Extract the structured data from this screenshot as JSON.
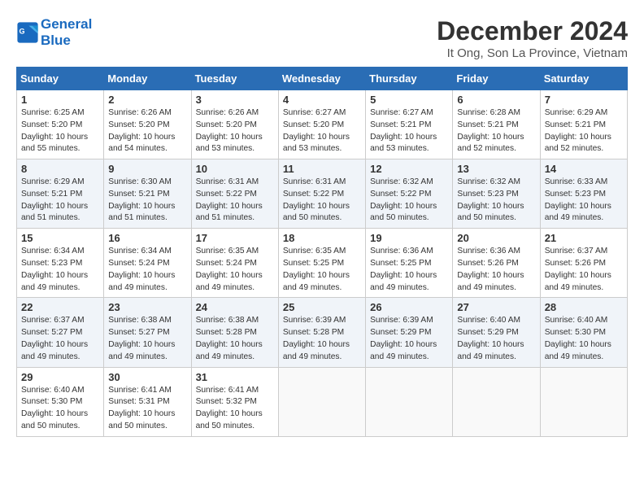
{
  "logo": {
    "line1": "General",
    "line2": "Blue"
  },
  "title": "December 2024",
  "subtitle": "It Ong, Son La Province, Vietnam",
  "weekdays": [
    "Sunday",
    "Monday",
    "Tuesday",
    "Wednesday",
    "Thursday",
    "Friday",
    "Saturday"
  ],
  "weeks": [
    [
      {
        "day": "1",
        "sunrise": "6:25 AM",
        "sunset": "5:20 PM",
        "daylight": "10 hours and 55 minutes."
      },
      {
        "day": "2",
        "sunrise": "6:26 AM",
        "sunset": "5:20 PM",
        "daylight": "10 hours and 54 minutes."
      },
      {
        "day": "3",
        "sunrise": "6:26 AM",
        "sunset": "5:20 PM",
        "daylight": "10 hours and 53 minutes."
      },
      {
        "day": "4",
        "sunrise": "6:27 AM",
        "sunset": "5:20 PM",
        "daylight": "10 hours and 53 minutes."
      },
      {
        "day": "5",
        "sunrise": "6:27 AM",
        "sunset": "5:21 PM",
        "daylight": "10 hours and 53 minutes."
      },
      {
        "day": "6",
        "sunrise": "6:28 AM",
        "sunset": "5:21 PM",
        "daylight": "10 hours and 52 minutes."
      },
      {
        "day": "7",
        "sunrise": "6:29 AM",
        "sunset": "5:21 PM",
        "daylight": "10 hours and 52 minutes."
      }
    ],
    [
      {
        "day": "8",
        "sunrise": "6:29 AM",
        "sunset": "5:21 PM",
        "daylight": "10 hours and 51 minutes."
      },
      {
        "day": "9",
        "sunrise": "6:30 AM",
        "sunset": "5:21 PM",
        "daylight": "10 hours and 51 minutes."
      },
      {
        "day": "10",
        "sunrise": "6:31 AM",
        "sunset": "5:22 PM",
        "daylight": "10 hours and 51 minutes."
      },
      {
        "day": "11",
        "sunrise": "6:31 AM",
        "sunset": "5:22 PM",
        "daylight": "10 hours and 50 minutes."
      },
      {
        "day": "12",
        "sunrise": "6:32 AM",
        "sunset": "5:22 PM",
        "daylight": "10 hours and 50 minutes."
      },
      {
        "day": "13",
        "sunrise": "6:32 AM",
        "sunset": "5:23 PM",
        "daylight": "10 hours and 50 minutes."
      },
      {
        "day": "14",
        "sunrise": "6:33 AM",
        "sunset": "5:23 PM",
        "daylight": "10 hours and 49 minutes."
      }
    ],
    [
      {
        "day": "15",
        "sunrise": "6:34 AM",
        "sunset": "5:23 PM",
        "daylight": "10 hours and 49 minutes."
      },
      {
        "day": "16",
        "sunrise": "6:34 AM",
        "sunset": "5:24 PM",
        "daylight": "10 hours and 49 minutes."
      },
      {
        "day": "17",
        "sunrise": "6:35 AM",
        "sunset": "5:24 PM",
        "daylight": "10 hours and 49 minutes."
      },
      {
        "day": "18",
        "sunrise": "6:35 AM",
        "sunset": "5:25 PM",
        "daylight": "10 hours and 49 minutes."
      },
      {
        "day": "19",
        "sunrise": "6:36 AM",
        "sunset": "5:25 PM",
        "daylight": "10 hours and 49 minutes."
      },
      {
        "day": "20",
        "sunrise": "6:36 AM",
        "sunset": "5:26 PM",
        "daylight": "10 hours and 49 minutes."
      },
      {
        "day": "21",
        "sunrise": "6:37 AM",
        "sunset": "5:26 PM",
        "daylight": "10 hours and 49 minutes."
      }
    ],
    [
      {
        "day": "22",
        "sunrise": "6:37 AM",
        "sunset": "5:27 PM",
        "daylight": "10 hours and 49 minutes."
      },
      {
        "day": "23",
        "sunrise": "6:38 AM",
        "sunset": "5:27 PM",
        "daylight": "10 hours and 49 minutes."
      },
      {
        "day": "24",
        "sunrise": "6:38 AM",
        "sunset": "5:28 PM",
        "daylight": "10 hours and 49 minutes."
      },
      {
        "day": "25",
        "sunrise": "6:39 AM",
        "sunset": "5:28 PM",
        "daylight": "10 hours and 49 minutes."
      },
      {
        "day": "26",
        "sunrise": "6:39 AM",
        "sunset": "5:29 PM",
        "daylight": "10 hours and 49 minutes."
      },
      {
        "day": "27",
        "sunrise": "6:40 AM",
        "sunset": "5:29 PM",
        "daylight": "10 hours and 49 minutes."
      },
      {
        "day": "28",
        "sunrise": "6:40 AM",
        "sunset": "5:30 PM",
        "daylight": "10 hours and 49 minutes."
      }
    ],
    [
      {
        "day": "29",
        "sunrise": "6:40 AM",
        "sunset": "5:30 PM",
        "daylight": "10 hours and 50 minutes."
      },
      {
        "day": "30",
        "sunrise": "6:41 AM",
        "sunset": "5:31 PM",
        "daylight": "10 hours and 50 minutes."
      },
      {
        "day": "31",
        "sunrise": "6:41 AM",
        "sunset": "5:32 PM",
        "daylight": "10 hours and 50 minutes."
      },
      null,
      null,
      null,
      null
    ]
  ],
  "labels": {
    "sunrise": "Sunrise:",
    "sunset": "Sunset:",
    "daylight": "Daylight:"
  }
}
